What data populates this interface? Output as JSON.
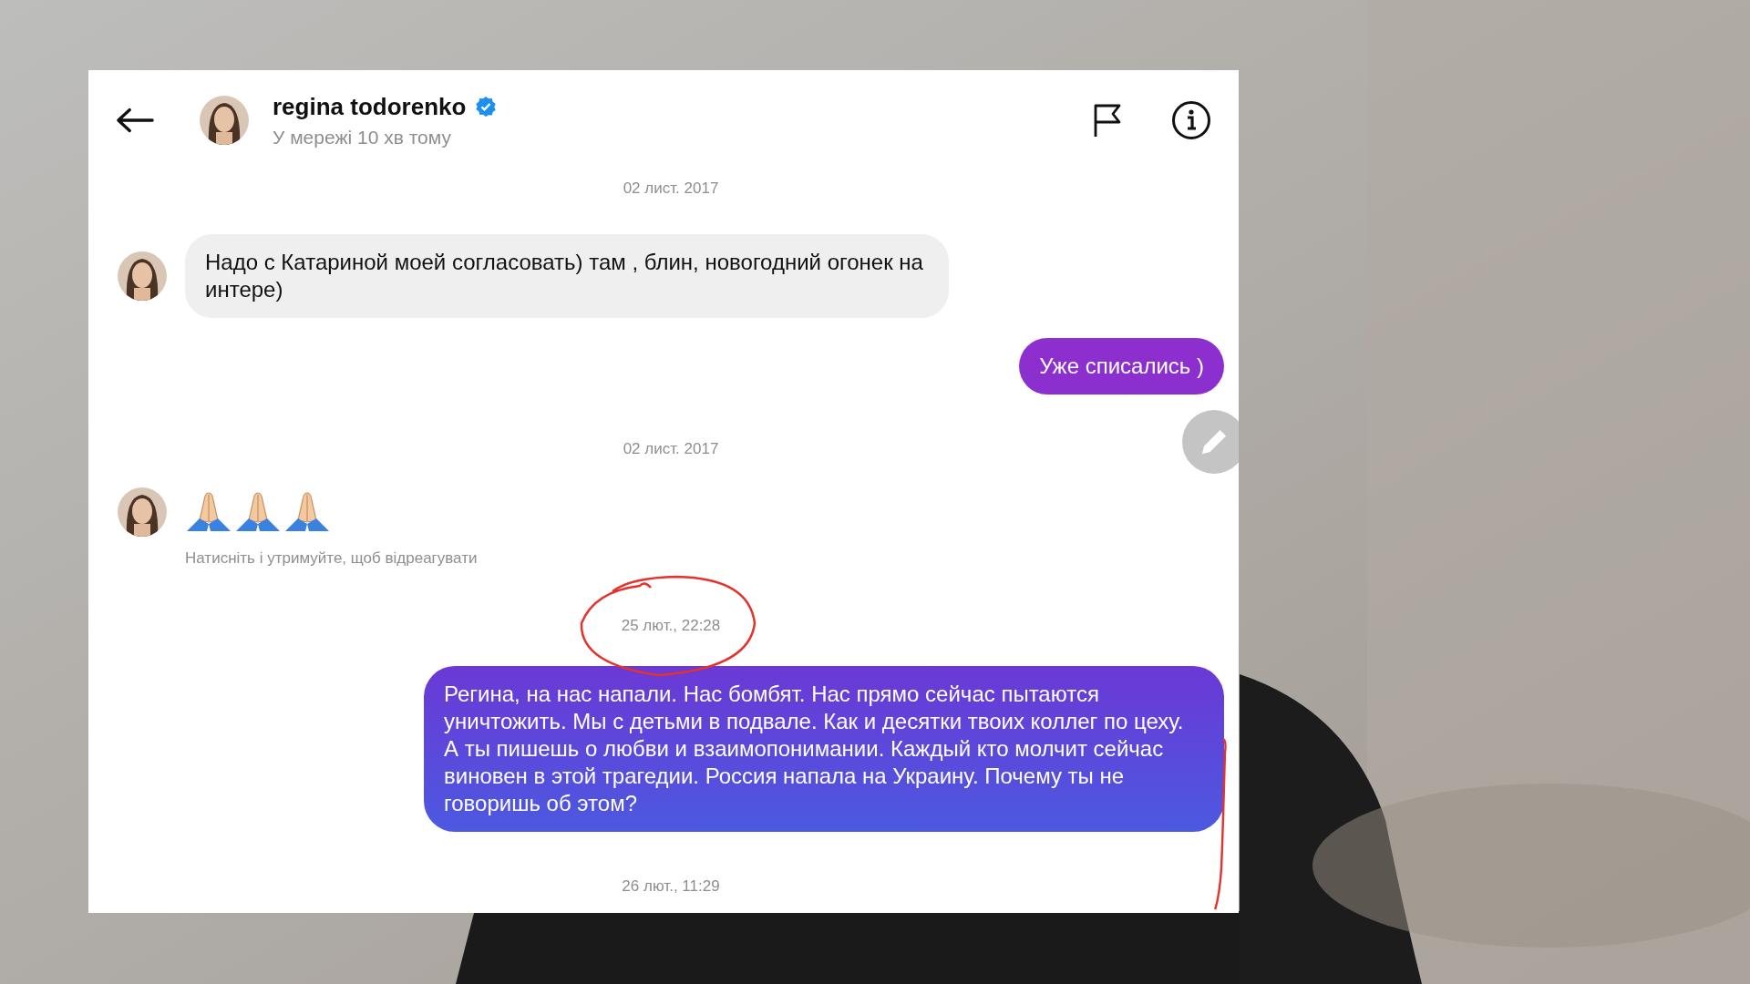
{
  "header": {
    "name": "regina todorenko",
    "verified": true,
    "status": "У мережі 10 хв тому"
  },
  "messages": [
    {
      "kind": "date",
      "text": "02 лист. 2017",
      "circled": false
    },
    {
      "kind": "incoming",
      "text": "Надо с Катариной моей согласовать) там , блин, новогодний огонек на интере)"
    },
    {
      "kind": "outgoing",
      "text": "Уже списались )"
    },
    {
      "kind": "date",
      "text": "02 лист. 2017",
      "circled": false
    },
    {
      "kind": "incoming_emoji",
      "hint": "Натисніть і утримуйте, щоб відреагувати"
    },
    {
      "kind": "date",
      "text": "25 лют., 22:28",
      "circled": true
    },
    {
      "kind": "outgoing",
      "text": "Регина, на нас напали. Нас бомбят. Нас прямо сейчас пытаются уничтожить. Мы с детьми в подвале. Как и десятки твоих коллег по цеху. А ты пишешь о любви и взаимопонимании. Каждый кто молчит сейчас виновен в этой трагедии. Россия напала на Украину. Почему ты не говоришь об этом?"
    },
    {
      "kind": "date",
      "text": "26 лют., 11:29",
      "circled": false
    }
  ]
}
